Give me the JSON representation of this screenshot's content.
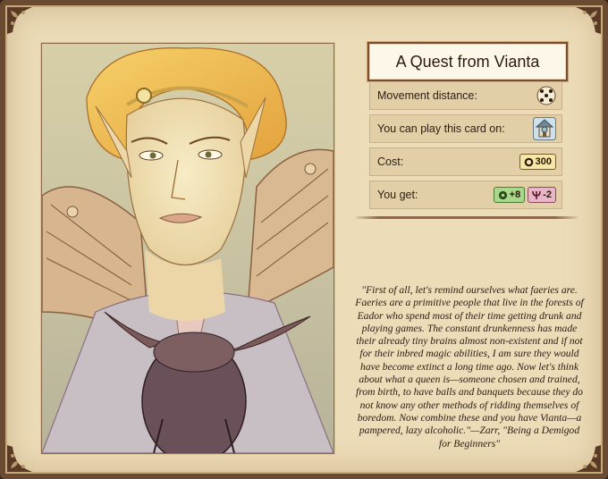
{
  "card": {
    "title": "A Quest from Vianta"
  },
  "stats": [
    {
      "label": "Movement distance:",
      "icon": "dice-icon"
    },
    {
      "label": "You can play this card on:",
      "icon": "shrine-building-icon"
    },
    {
      "label": "Cost:",
      "icon": "gold-coin-icon",
      "value": "300"
    },
    {
      "label": "You get:",
      "rewards": [
        {
          "icon": "plus-gear-icon",
          "value": "+8",
          "color": "#a8d889"
        },
        {
          "icon": "minus-psi-icon",
          "value": "-2",
          "color": "#e8b6c6"
        }
      ]
    }
  ],
  "quote": "\"First of all, let's remind ourselves what faeries are. Faeries are a primitive people that live in the forests of Eador who spend most of their time getting drunk and playing games. The constant drunkenness has made their already tiny brains almost non-existent and if not for their inbred magic abilities, I am sure they would have become extinct a long time ago. Now let's think about what a queen is—someone chosen and trained, from birth, to have balls and banquets because they do not know any other methods of ridding themselves of boredom. Now combine these and you have Vianta—a pampered, lazy alcoholic.\"—Zarr, \"Being a Demigod for Beginners\""
}
